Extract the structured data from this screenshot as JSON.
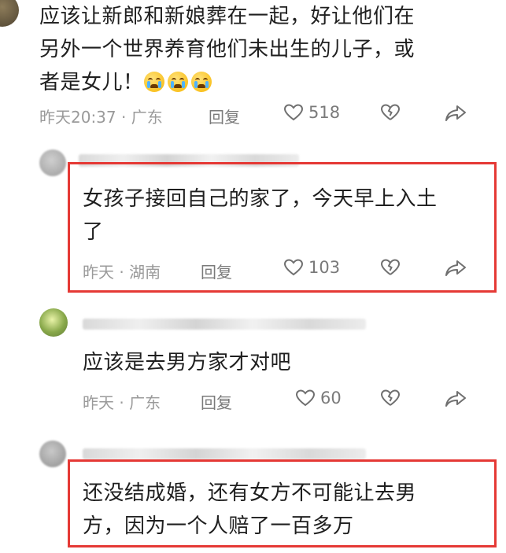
{
  "comment1": {
    "line1": "应该让新郎和新娘葬在一起，好让他们在",
    "line2": "另外一个世界养育他们未出生的儿子，或",
    "line3": "者是女儿！",
    "emojis": [
      "crying-face",
      "crying-face",
      "crying-face"
    ],
    "meta": "昨天20:37 · 广东",
    "reply": "回复",
    "likes": "518"
  },
  "reply1": {
    "line1": "女孩子接回自己的家了，今天早上入土",
    "line2": "了",
    "meta": "昨天 · 湖南",
    "reply": "回复",
    "likes": "103"
  },
  "reply2": {
    "line1": "应该是去男方家才对吧",
    "meta": "昨天 · 广东",
    "reply": "回复",
    "likes": "60"
  },
  "reply3": {
    "line1": "还没结成婚，还有女方不可能让去男",
    "line2": "方，因为一个人赔了一百多万"
  },
  "colors": {
    "highlight": "#e53935",
    "meta_gray": "#9a9a9a",
    "icon_gray": "#7a7a7a"
  }
}
